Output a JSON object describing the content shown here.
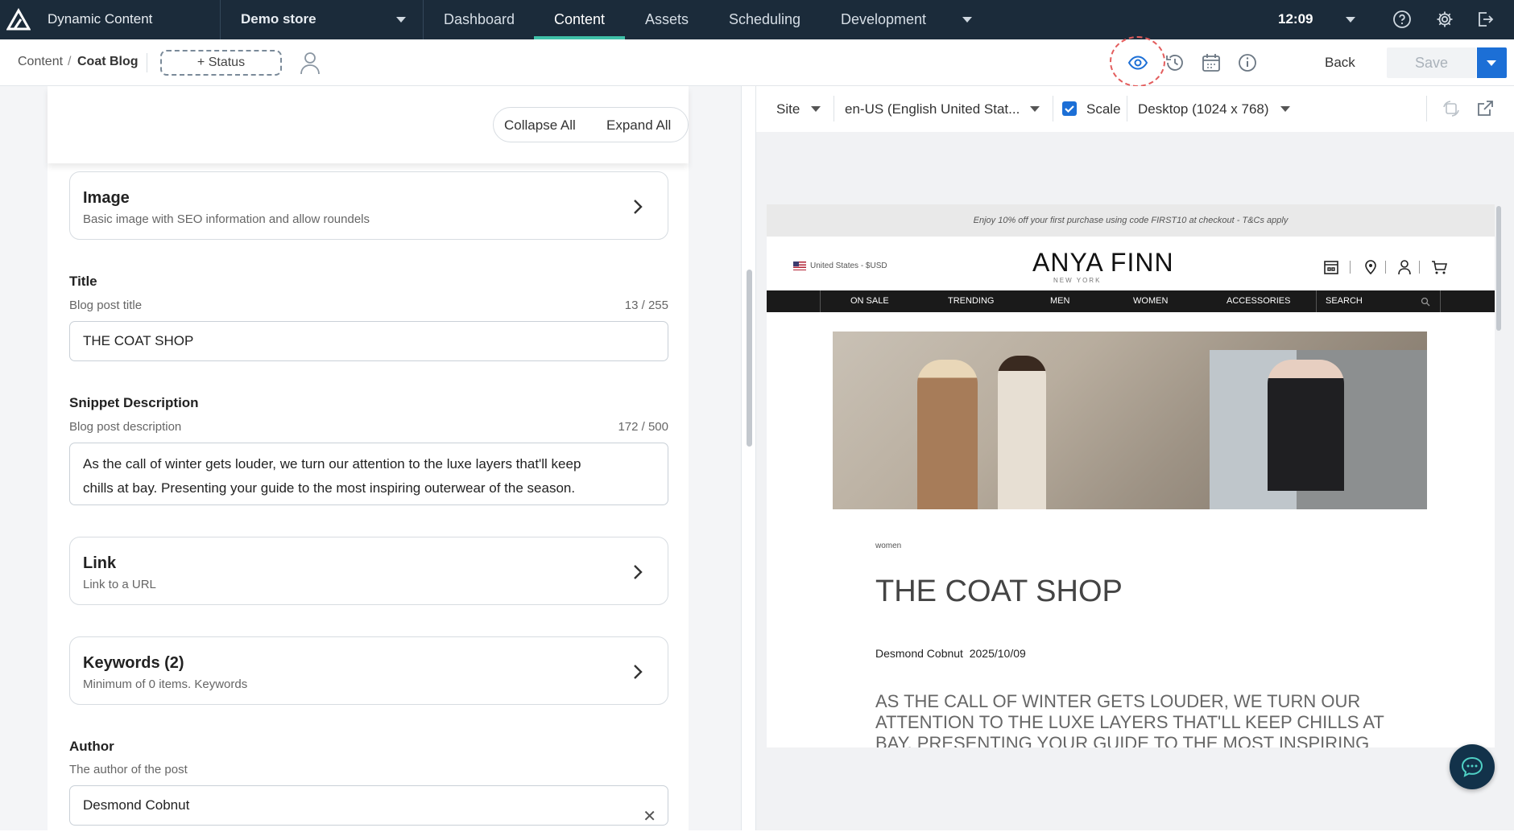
{
  "topbar": {
    "app_name": "Dynamic Content",
    "store": "Demo store",
    "nav": [
      "Dashboard",
      "Content",
      "Assets",
      "Scheduling",
      "Development"
    ],
    "active_nav": "Content",
    "clock": "12:09"
  },
  "subbar": {
    "breadcrumb_root": "Content",
    "breadcrumb_sep": "/",
    "breadcrumb_current": "Coat Blog",
    "status_button": "+ Status",
    "back": "Back",
    "save": "Save"
  },
  "form": {
    "collapse_all": "Collapse All",
    "expand_all": "Expand All",
    "image_card": {
      "title": "Image",
      "subtitle": "Basic image with SEO information and allow roundels"
    },
    "title_field": {
      "label": "Title",
      "hint": "Blog post title",
      "count": "13 / 255",
      "value": "THE COAT SHOP"
    },
    "snippet_field": {
      "label": "Snippet Description",
      "hint": "Blog post description",
      "count": "172 / 500",
      "line1": "As the call of winter gets louder, we turn our attention to the luxe layers that'll keep",
      "line2": "chills at bay. Presenting your guide to the most inspiring outerwear of the season."
    },
    "link_card": {
      "title": "Link",
      "subtitle": "Link to a URL"
    },
    "keywords_card": {
      "title": "Keywords (2)",
      "subtitle": "Minimum of 0 items. Keywords"
    },
    "author_field": {
      "label": "Author",
      "hint": "The author of the post",
      "value": "Desmond Cobnut"
    }
  },
  "preview": {
    "site": "Site",
    "locale": "en-US (English United Stat...",
    "scale_label": "Scale",
    "scale_checked": true,
    "device": "Desktop (1024 x 768)",
    "promo": "Enjoy 10% off your first purchase using code FIRST10 at checkout - T&Cs apply",
    "region": "United States - $USD",
    "brand": "ANYA FINN",
    "brand_sub": "NEW YORK",
    "site_nav": [
      "ON SALE",
      "TRENDING",
      "MEN",
      "WOMEN",
      "ACCESSORIES"
    ],
    "search_placeholder": "SEARCH",
    "post_category": "women",
    "post_title": "THE COAT SHOP",
    "post_author": "Desmond Cobnut",
    "post_date": "2025/10/09",
    "post_body": "AS THE CALL OF WINTER GETS LOUDER, WE TURN OUR ATTENTION TO THE LUXE LAYERS THAT'LL KEEP CHILLS AT BAY. PRESENTING YOUR GUIDE TO THE MOST INSPIRING OUTERWEAR OF THE SEASON."
  },
  "colors": {
    "topbar": "#1b2b3a",
    "accent": "#3fc0a8",
    "primary": "#1c6fd6",
    "highlight": "#e35d5d"
  }
}
